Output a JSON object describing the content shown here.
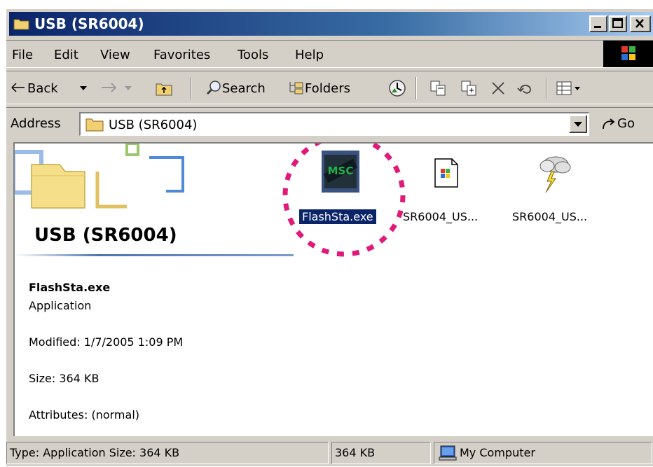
{
  "window": {
    "title": "USB (SR6004)"
  },
  "menu": {
    "items": [
      "File",
      "Edit",
      "View",
      "Favorites",
      "Tools",
      "Help"
    ]
  },
  "toolbar": {
    "back_label": "Back",
    "search_label": "Search",
    "folders_label": "Folders"
  },
  "address": {
    "label": "Address",
    "value": "USB (SR6004)",
    "go_label": "Go"
  },
  "folder_panel": {
    "title": "USB (SR6004)",
    "file_name": "FlashSta.exe",
    "file_type": "Application",
    "modified": "Modified: 1/7/2005 1:09 PM",
    "size": "Size: 364 KB",
    "attributes": "Attributes: (normal)"
  },
  "files": [
    {
      "label": "FlashSta.exe",
      "icon": "chip-application-icon",
      "selected": true
    },
    {
      "label": "SR6004_US...",
      "icon": "setup-document-icon",
      "selected": false
    },
    {
      "label": "SR6004_US...",
      "icon": "storm-cloud-icon",
      "selected": false
    }
  ],
  "status": {
    "type_info": "Type: Application Size: 364 KB",
    "size": "364 KB",
    "zone": "My Computer"
  },
  "colors": {
    "highlight_circle": "#e0197a",
    "selection": "#0a246a",
    "titlebar": "#0a246a"
  }
}
